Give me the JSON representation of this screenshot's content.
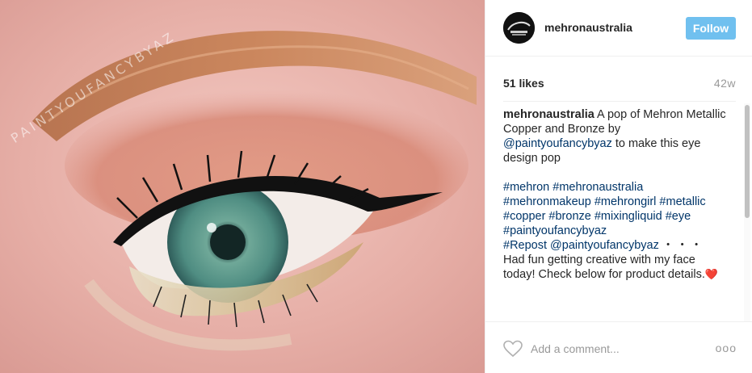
{
  "photo": {
    "watermark": "PAINTYOUFANCYBYAZ",
    "alt": "Eye makeup with metallic copper and bronze"
  },
  "header": {
    "avatar_text": "mehron",
    "username": "mehronaustralia",
    "follow_label": "Follow"
  },
  "stats": {
    "likes": "51 likes",
    "time": "42w"
  },
  "caption": {
    "author": "mehronaustralia",
    "text_1": " A pop of Mehron Metallic Copper and Bronze by ",
    "mention": "@paintyoufancybyaz",
    "text_2": " to make this eye design pop",
    "hashtags": "#mehron #mehronaustralia #mehronmakeup #mehrongirl #metallic #copper #bronze #mixingliquid #eye #paintyoufancybyaz",
    "repost": "#Repost @paintyoufancybyaz",
    "more": "・・・",
    "text_3": "Had fun getting creative with my face today! Check below for product details.",
    "emoji": "❤️"
  },
  "footer": {
    "comment_placeholder": "Add a comment...",
    "options": "ooo"
  },
  "colors": {
    "follow": "#70c0ef",
    "link": "#003569",
    "muted": "#999999",
    "skin": "#e9b8b2"
  },
  "icons": {
    "like": "heart-outline-icon",
    "options": "more-options-icon"
  }
}
